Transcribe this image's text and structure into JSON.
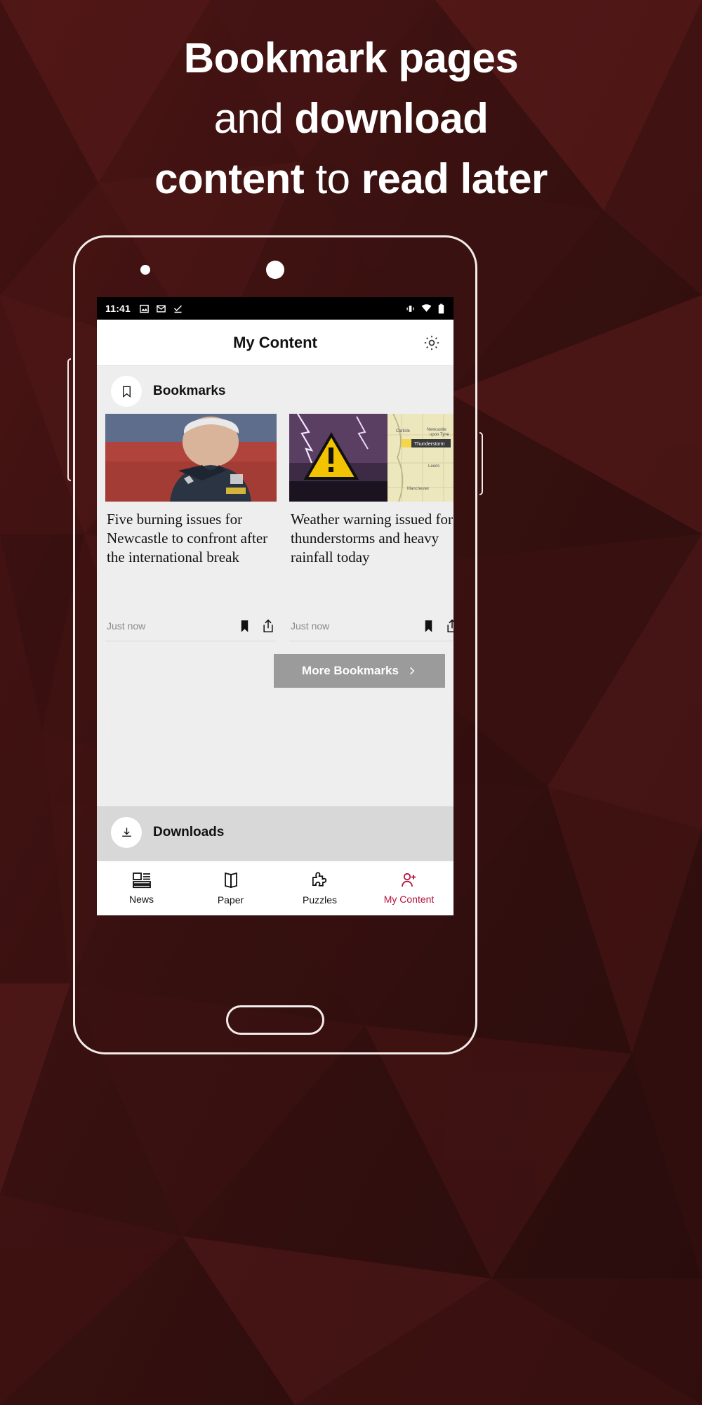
{
  "promo": {
    "headline_line1_bold": "Bookmark pages",
    "headline_line2_light": "and ",
    "headline_line2_bold": "download",
    "headline_line3_bold_a": "content",
    "headline_line3_light": " to ",
    "headline_line3_bold_b": "read later",
    "background_color": "#3a1111",
    "accent_color": "#b3123b"
  },
  "phone": {
    "status_bar": {
      "time": "11:41",
      "left_icons": [
        "image-icon",
        "gmail-icon",
        "task-done-icon"
      ],
      "right_icons": [
        "vibrate-icon",
        "wifi-icon",
        "battery-icon"
      ]
    },
    "android_nav": [
      "back-icon",
      "home-icon",
      "recents-icon"
    ]
  },
  "app": {
    "header": {
      "title": "My Content",
      "settings_icon": "gear-icon"
    },
    "sections": [
      {
        "id": "bookmarks",
        "icon": "bookmark-outline-icon",
        "title": "Bookmarks"
      },
      {
        "id": "downloads",
        "icon": "download-circle-icon",
        "title": "Downloads"
      }
    ],
    "bookmark_cards": [
      {
        "image": "football-manager-photo",
        "title": "Five burning issues for Newcastle to confront after the international break",
        "time": "Just now",
        "bookmark_icon": "bookmark-filled-icon",
        "share_icon": "share-icon"
      },
      {
        "image": "weather-warning-photo",
        "title": "Weather warning issued for thunderstorms and heavy rainfall today",
        "time": "Just now",
        "bookmark_icon": "bookmark-filled-icon",
        "share_icon": "share-icon"
      }
    ],
    "more_bookmarks": {
      "label": "More Bookmarks",
      "chevron": "chevron-right-icon",
      "background": "#9b9b9b"
    },
    "bottom_nav": [
      {
        "label": "News",
        "icon": "news-layout-icon",
        "active": false
      },
      {
        "label": "Paper",
        "icon": "paper-fold-icon",
        "active": false
      },
      {
        "label": "Puzzles",
        "icon": "puzzle-piece-icon",
        "active": false
      },
      {
        "label": "My Content",
        "icon": "person-plus-icon",
        "active": true
      }
    ]
  },
  "weather_card_map": {
    "warning_badge": "Thunderstorm",
    "place_labels": [
      "Carlisle",
      "Newcastle upon Tyne",
      "Leeds",
      "Manchester"
    ]
  }
}
